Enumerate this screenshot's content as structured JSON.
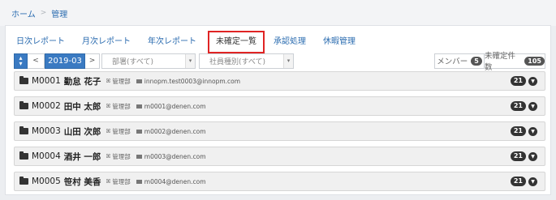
{
  "breadcrumb": {
    "home": "ホーム",
    "separator": ">",
    "current": "管理"
  },
  "tabs": [
    {
      "label": "日次レポート",
      "active": false
    },
    {
      "label": "月次レポート",
      "active": false
    },
    {
      "label": "年次レポート",
      "active": false
    },
    {
      "label": "未確定一覧",
      "active": true
    },
    {
      "label": "承認処理",
      "active": false
    },
    {
      "label": "休暇管理",
      "active": false
    }
  ],
  "toolbar": {
    "sort_icon": "sort-updown-icon",
    "prev_label": "<",
    "month": "2019-03",
    "next_label": ">",
    "dept_placeholder": "部署(すべて)",
    "type_placeholder": "社員種別(すべて)",
    "caret": "▾",
    "members_label": "メンバー",
    "members_count": "5",
    "unconfirmed_label": "未確定件数",
    "unconfirmed_count": "105"
  },
  "members": [
    {
      "code": "M0001",
      "name": "勤怠 花子",
      "dept": "管理部",
      "email": "innopm.test0003@innopm.com",
      "count": "21"
    },
    {
      "code": "M0002",
      "name": "田中 太郎",
      "dept": "管理部",
      "email": "m0001@denen.com",
      "count": "21"
    },
    {
      "code": "M0003",
      "name": "山田 次郎",
      "dept": "管理部",
      "email": "m0002@denen.com",
      "count": "21"
    },
    {
      "code": "M0004",
      "name": "酒井 一郎",
      "dept": "管理部",
      "email": "m0003@denen.com",
      "count": "21"
    },
    {
      "code": "M0005",
      "name": "笹村 美香",
      "dept": "管理部",
      "email": "m0004@denen.com",
      "count": "21"
    }
  ],
  "colors": {
    "accent": "#3a7ac2",
    "link": "#2b6cb0",
    "highlight": "#e02424"
  }
}
